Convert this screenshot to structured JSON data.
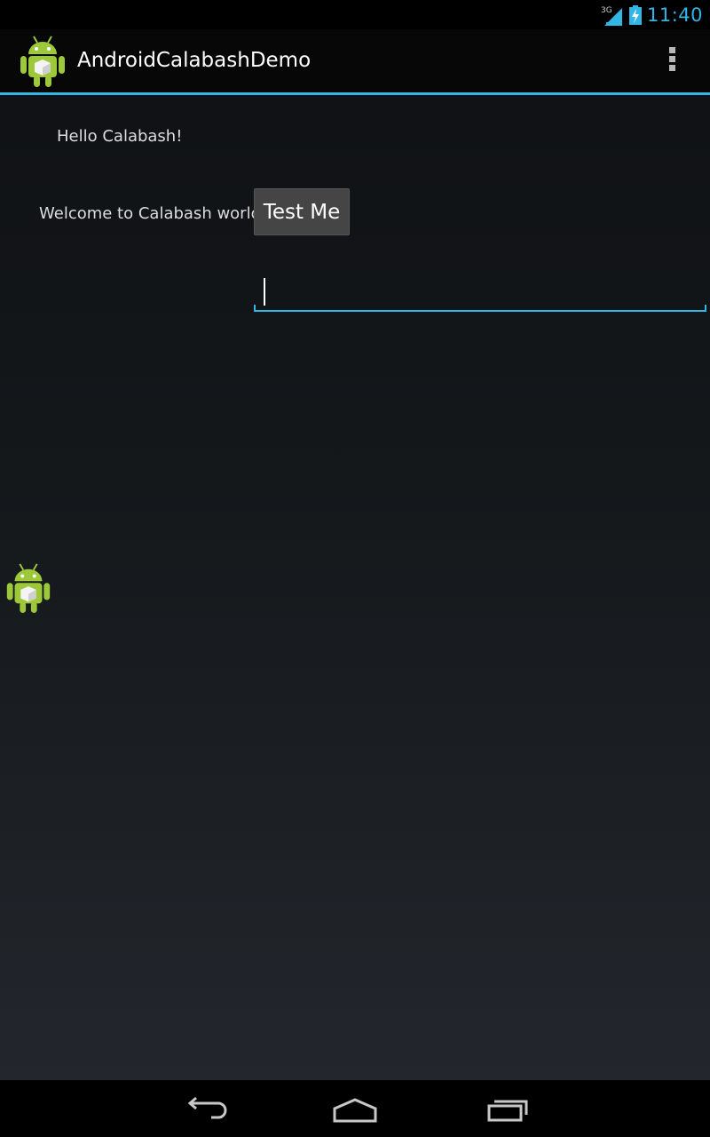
{
  "status_bar": {
    "network_label": "3G",
    "time": "11:40",
    "icons": [
      "signal-icon",
      "battery-charging-icon"
    ]
  },
  "action_bar": {
    "title": "AndroidCalabashDemo",
    "app_icon": "android-robot-icon",
    "overflow_icon": "overflow-menu-icon"
  },
  "main": {
    "hello_text": "Hello Calabash!",
    "welcome_text": "Welcome to Calabash world",
    "test_button_label": "Test Me",
    "input_value": "",
    "image_icon": "android-robot-icon"
  },
  "nav_bar": {
    "icons": [
      "back-icon",
      "home-icon",
      "recent-apps-icon"
    ]
  },
  "colors": {
    "accent": "#33b5e5",
    "background": "#101215",
    "text": "#dcdcdc"
  }
}
